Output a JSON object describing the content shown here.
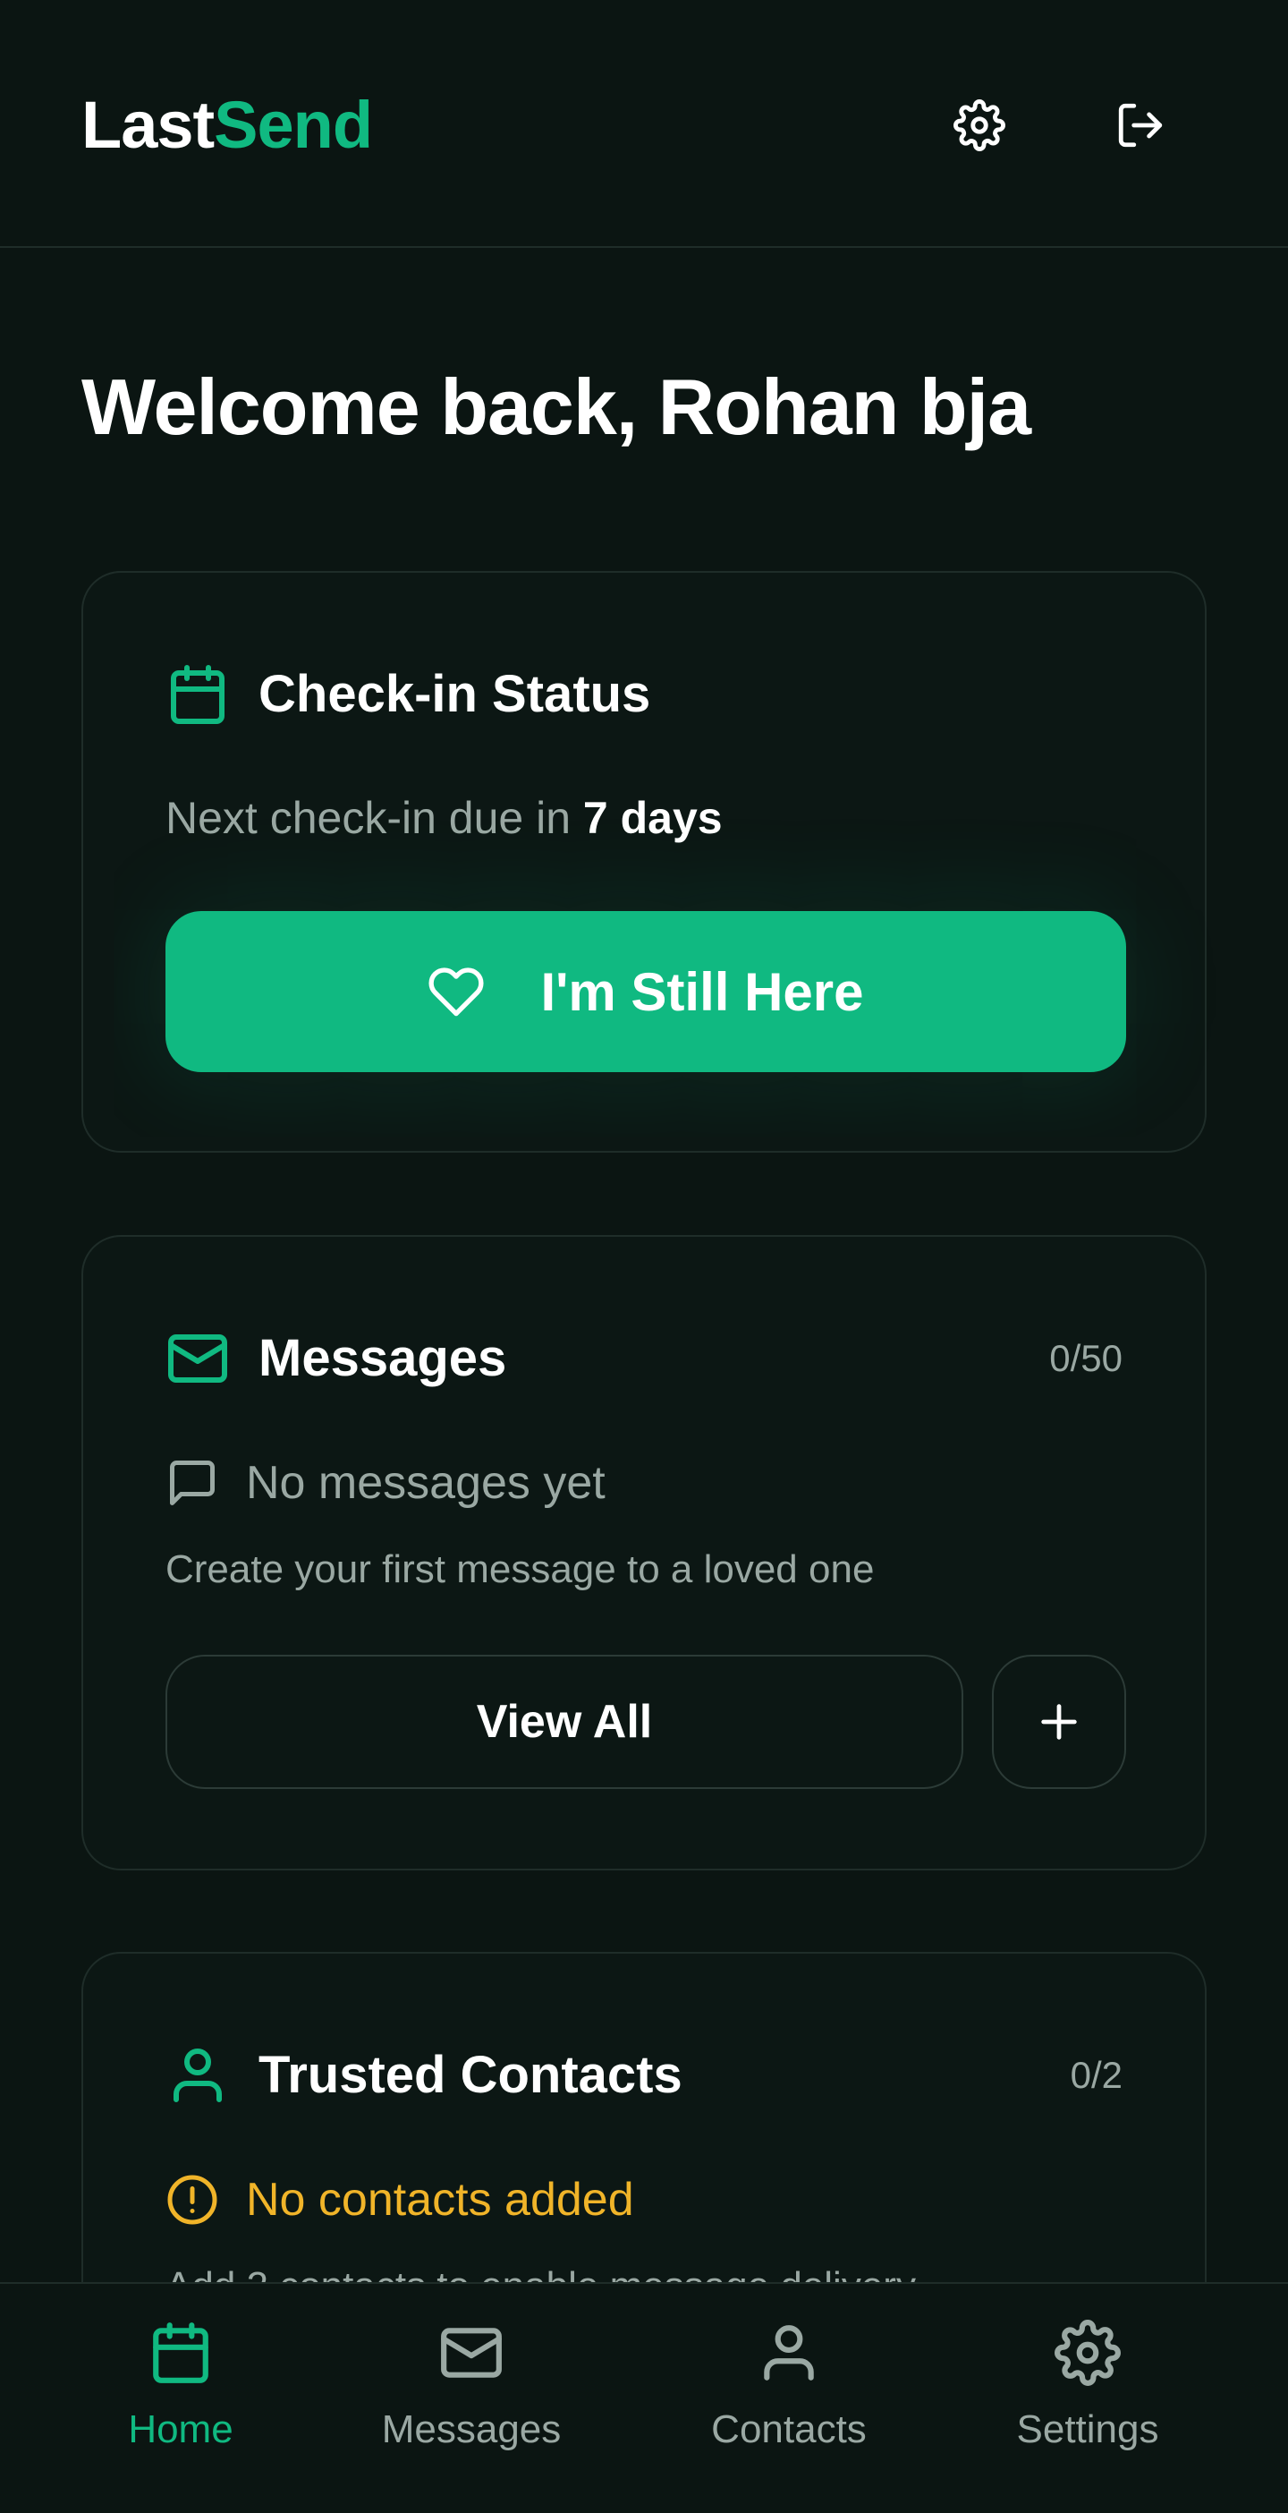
{
  "brand": {
    "part1": "Last",
    "part2": "Send"
  },
  "header": {
    "settings_icon": "gear-icon",
    "logout_icon": "logout-icon"
  },
  "welcome": "Welcome back, Rohan bja",
  "checkin": {
    "title": "Check-in Status",
    "due_prefix": "Next check-in due in ",
    "due_value": "7 days",
    "button_label": "I'm Still Here"
  },
  "messages": {
    "title": "Messages",
    "count": "0/50",
    "empty_title": "No messages yet",
    "empty_sub": "Create your first message to a loved one",
    "view_all_label": "View All",
    "add_label": "+"
  },
  "contacts": {
    "title": "Trusted Contacts",
    "count": "0/2",
    "warning": "No contacts added",
    "sub": "Add 2 contacts to enable message delivery"
  },
  "nav": [
    {
      "label": "Home",
      "icon": "calendar-icon",
      "active": true
    },
    {
      "label": "Messages",
      "icon": "mail-icon",
      "active": false
    },
    {
      "label": "Contacts",
      "icon": "user-icon",
      "active": false
    },
    {
      "label": "Settings",
      "icon": "gear-icon",
      "active": false
    }
  ],
  "colors": {
    "background": "#0b1512",
    "accent": "#10b981",
    "warning": "#f0b429",
    "muted_text": "#9aa8a3",
    "border": "#1f2d29"
  }
}
